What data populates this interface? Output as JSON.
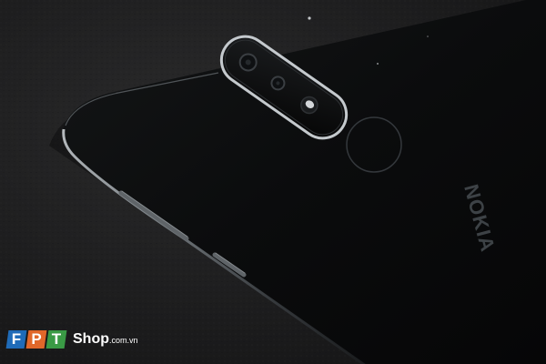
{
  "photo": {
    "subject": "back of a black smartphone with dual camera and fingerprint sensor on leather surface",
    "phone_brand_print": "NOKIA",
    "colors": {
      "background_leather": "#1c1c1d",
      "phone_body": "#0a0b0c",
      "edge_highlight": "#9ba2a8"
    }
  },
  "watermark": {
    "letters": [
      "F",
      "P",
      "T"
    ],
    "site_name": "Shop",
    "site_suffix": ".com.vn",
    "tile_colors": [
      "#1f6bb8",
      "#e0672a",
      "#3a9a45"
    ]
  }
}
